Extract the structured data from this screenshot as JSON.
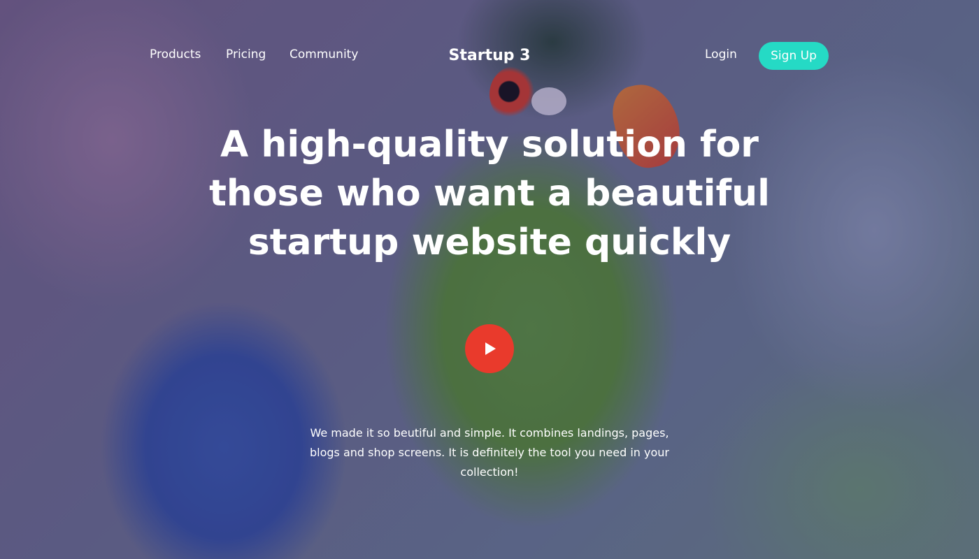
{
  "nav": {
    "left_links": [
      "Products",
      "Pricing",
      "Community"
    ],
    "brand": "Startup 3",
    "login": "Login",
    "signup": "Sign Up"
  },
  "hero": {
    "headline": "A high-quality solution for those who want a beautiful startup website quickly",
    "description": "We made it so beutiful and simple. It combines landings, pages, blogs and shop screens. It is definitely the tool you need in your collection!",
    "play_icon": "play-icon"
  },
  "colors": {
    "accent": "#25dac5",
    "play_button": "#e93a2c",
    "text": "#ffffff"
  }
}
